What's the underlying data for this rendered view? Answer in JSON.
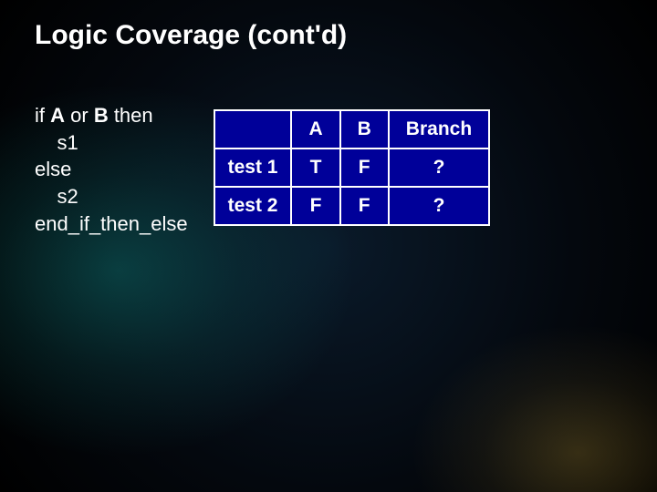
{
  "title": "Logic Coverage (cont'd)",
  "code": {
    "l1_if": "if ",
    "l1_a": "A",
    "l1_or": " or ",
    "l1_b": "B",
    "l1_then": " then",
    "l2": "    s1",
    "l3": "else",
    "l4": "    s2",
    "l5": "end_if_then_else"
  },
  "table": {
    "headers": {
      "blank": "",
      "a": "A",
      "b": "B",
      "branch": "Branch"
    },
    "rows": [
      {
        "label": "test 1",
        "a": "T",
        "b": "F",
        "branch": "?"
      },
      {
        "label": "test 2",
        "a": "F",
        "b": "F",
        "branch": "?"
      }
    ]
  }
}
